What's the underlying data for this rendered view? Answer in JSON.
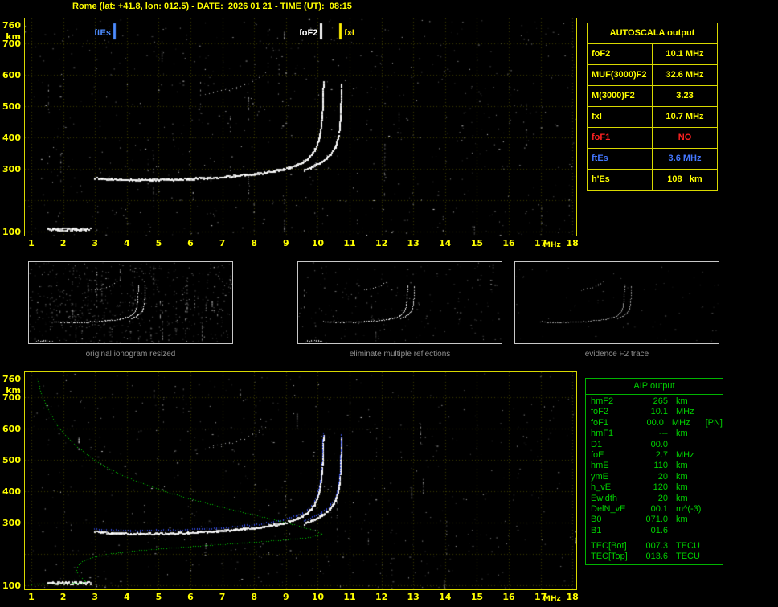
{
  "header": {
    "title": "Rome (lat: +41.8, lon: 012.5) - DATE:  2026 01 21 - TIME (UT):  08:15"
  },
  "autoscala_table": {
    "title": "AUTOSCALA output",
    "rows": [
      {
        "label": "foF2",
        "value": "10.1 MHz",
        "color": "#ffff00"
      },
      {
        "label": "MUF(3000)F2",
        "value": "32.6 MHz",
        "color": "#ffff00"
      },
      {
        "label": "M(3000)F2",
        "value": "3.23",
        "color": "#ffff00"
      },
      {
        "label": "fxI",
        "value": "10.7 MHz",
        "color": "#ffff00"
      },
      {
        "label": "foF1",
        "value": "NO",
        "color": "#ff2222"
      },
      {
        "label": "ftEs",
        "value": "3.6 MHz",
        "color": "#4477ff"
      },
      {
        "label": "h'Es",
        "value": "108   km",
        "color": "#ffff00"
      }
    ]
  },
  "thumbnails": [
    {
      "caption": "original ionogram resized"
    },
    {
      "caption": "eliminate multiple reflections"
    },
    {
      "caption": "evidence F2 trace"
    }
  ],
  "aip_table": {
    "title": "AIP output",
    "rows": [
      {
        "name": "hmF2",
        "value": "265",
        "unit": "km",
        "note": ""
      },
      {
        "name": "foF2",
        "value": "10.1",
        "unit": "MHz",
        "note": ""
      },
      {
        "name": "foF1",
        "value": "00.0",
        "unit": "MHz",
        "note": "[PN]"
      },
      {
        "name": "hmF1",
        "value": "---",
        "unit": "km",
        "note": ""
      },
      {
        "name": "D1",
        "value": "00.0",
        "unit": "",
        "note": ""
      },
      {
        "name": "foE",
        "value": "2.7",
        "unit": "MHz",
        "note": ""
      },
      {
        "name": "hmE",
        "value": "110",
        "unit": "km",
        "note": ""
      },
      {
        "name": "ymE",
        "value": "20",
        "unit": "km",
        "note": ""
      },
      {
        "name": "h_vE",
        "value": "120",
        "unit": "km",
        "note": ""
      },
      {
        "name": "Ewidth",
        "value": "20",
        "unit": "km",
        "note": ""
      },
      {
        "name": "DelN_vE",
        "value": "00.1",
        "unit": "m^(-3)",
        "note": ""
      },
      {
        "name": "B0",
        "value": "071.0",
        "unit": "km",
        "note": ""
      },
      {
        "name": "B1",
        "value": "01.6",
        "unit": "",
        "note": ""
      }
    ],
    "tec_rows": [
      {
        "name": "TEC[Bot]",
        "value": "007.3",
        "unit": "TECU"
      },
      {
        "name": "TEC[Top]",
        "value": "013.6",
        "unit": "TECU"
      }
    ]
  },
  "chart_data": {
    "type": "scatter",
    "plots": [
      {
        "id": "main_ionogram",
        "panel": "top",
        "xlabel": "MHz",
        "ylabel": "km",
        "xlim": [
          1,
          18
        ],
        "ylim": [
          90,
          765
        ],
        "grid": true
      },
      {
        "id": "profile_ionogram",
        "panel": "bottom",
        "xlabel": "MHz",
        "ylabel": "km",
        "xlim": [
          1,
          18
        ],
        "ylim": [
          90,
          765
        ],
        "grid": true
      }
    ],
    "x_ticks": [
      1,
      2,
      3,
      4,
      5,
      6,
      7,
      8,
      9,
      10,
      11,
      12,
      13,
      14,
      15,
      16,
      17,
      18
    ],
    "y_ticks": [
      760,
      700,
      600,
      500,
      400,
      300,
      100
    ],
    "x_unit": "MHz",
    "y_unit": "km",
    "main_markers": [
      {
        "label": "ftEs",
        "f": 3.6,
        "color": "#4d8cff",
        "side": "left"
      },
      {
        "label": "foF2",
        "f": 10.1,
        "color": "#ffffff",
        "side": "left"
      },
      {
        "label": "fxI",
        "f": 10.7,
        "color": "#ffee00",
        "side": "right"
      }
    ],
    "traces": {
      "f2_ordinary": [
        [
          2.98,
          272
        ],
        [
          3.2,
          270
        ],
        [
          3.5,
          268
        ],
        [
          3.8,
          267
        ],
        [
          4.1,
          266
        ],
        [
          4.4,
          266
        ],
        [
          4.7,
          266
        ],
        [
          5.0,
          267
        ],
        [
          5.3,
          267
        ],
        [
          5.6,
          268
        ],
        [
          5.9,
          269
        ],
        [
          6.2,
          271
        ],
        [
          6.5,
          272
        ],
        [
          6.8,
          274
        ],
        [
          7.1,
          276
        ],
        [
          7.4,
          279
        ],
        [
          7.7,
          282
        ],
        [
          8.0,
          285
        ],
        [
          8.3,
          289
        ],
        [
          8.6,
          294
        ],
        [
          8.9,
          300
        ],
        [
          9.1,
          306
        ],
        [
          9.3,
          313
        ],
        [
          9.5,
          322
        ],
        [
          9.65,
          333
        ],
        [
          9.78,
          346
        ],
        [
          9.88,
          360
        ],
        [
          9.96,
          377
        ],
        [
          10.02,
          397
        ],
        [
          10.06,
          418
        ],
        [
          10.09,
          440
        ],
        [
          10.11,
          464
        ],
        [
          10.13,
          490
        ],
        [
          10.14,
          516
        ],
        [
          10.15,
          542
        ],
        [
          10.155,
          565
        ],
        [
          10.16,
          578
        ]
      ],
      "f2_extraordinary": [
        [
          9.55,
          298
        ],
        [
          9.75,
          306
        ],
        [
          9.95,
          315
        ],
        [
          10.12,
          325
        ],
        [
          10.27,
          336
        ],
        [
          10.4,
          349
        ],
        [
          10.5,
          364
        ],
        [
          10.57,
          381
        ],
        [
          10.62,
          400
        ],
        [
          10.655,
          421
        ],
        [
          10.68,
          444
        ],
        [
          10.695,
          468
        ],
        [
          10.705,
          494
        ],
        [
          10.712,
          521
        ],
        [
          10.717,
          548
        ],
        [
          10.72,
          572
        ]
      ],
      "second_hop": [
        [
          6.45,
          540
        ],
        [
          6.7,
          544
        ],
        [
          6.95,
          549
        ],
        [
          7.2,
          555
        ],
        [
          7.45,
          562
        ],
        [
          7.7,
          571
        ],
        [
          7.95,
          582
        ],
        [
          8.15,
          593
        ],
        [
          8.35,
          605
        ]
      ],
      "sporadic_e": [
        [
          1.5,
          107
        ],
        [
          1.65,
          108
        ],
        [
          1.8,
          108
        ],
        [
          1.95,
          109
        ],
        [
          2.1,
          108
        ],
        [
          2.25,
          108
        ],
        [
          2.4,
          109
        ],
        [
          2.55,
          108
        ],
        [
          2.7,
          108
        ],
        [
          2.85,
          109
        ]
      ]
    },
    "profile_green": [
      [
        1.18,
        760
      ],
      [
        1.28,
        722
      ],
      [
        1.42,
        684
      ],
      [
        1.6,
        646
      ],
      [
        1.82,
        610
      ],
      [
        2.1,
        575
      ],
      [
        2.45,
        542
      ],
      [
        2.85,
        510
      ],
      [
        3.3,
        480
      ],
      [
        3.85,
        452
      ],
      [
        4.5,
        425
      ],
      [
        5.2,
        400
      ],
      [
        6.0,
        376
      ],
      [
        6.9,
        352
      ],
      [
        7.8,
        330
      ],
      [
        8.7,
        308
      ],
      [
        9.4,
        290
      ],
      [
        9.85,
        276
      ],
      [
        10.08,
        267
      ],
      [
        10.12,
        265
      ],
      [
        10.0,
        259
      ],
      [
        9.6,
        252
      ],
      [
        8.9,
        245
      ],
      [
        8.0,
        238
      ],
      [
        7.0,
        231
      ],
      [
        6.0,
        224
      ],
      [
        5.0,
        217
      ],
      [
        4.15,
        209
      ],
      [
        3.5,
        201
      ],
      [
        3.05,
        193
      ],
      [
        2.78,
        185
      ],
      [
        2.6,
        176
      ],
      [
        2.5,
        167
      ],
      [
        2.44,
        158
      ],
      [
        2.42,
        149
      ],
      [
        2.44,
        140
      ],
      [
        2.5,
        131
      ],
      [
        2.58,
        123
      ],
      [
        2.66,
        116
      ],
      [
        2.7,
        111
      ],
      [
        2.6,
        108
      ],
      [
        2.35,
        106
      ],
      [
        2.0,
        105
      ],
      [
        1.6,
        104
      ],
      [
        1.25,
        104
      ],
      [
        1.0,
        103
      ]
    ],
    "colors": {
      "axis": "#e8e800",
      "grid": "#3c3c00",
      "ionogram_trace": "#ffffff",
      "autoscaled_trace": "#3a55ff",
      "profile": "#00dd00"
    }
  }
}
